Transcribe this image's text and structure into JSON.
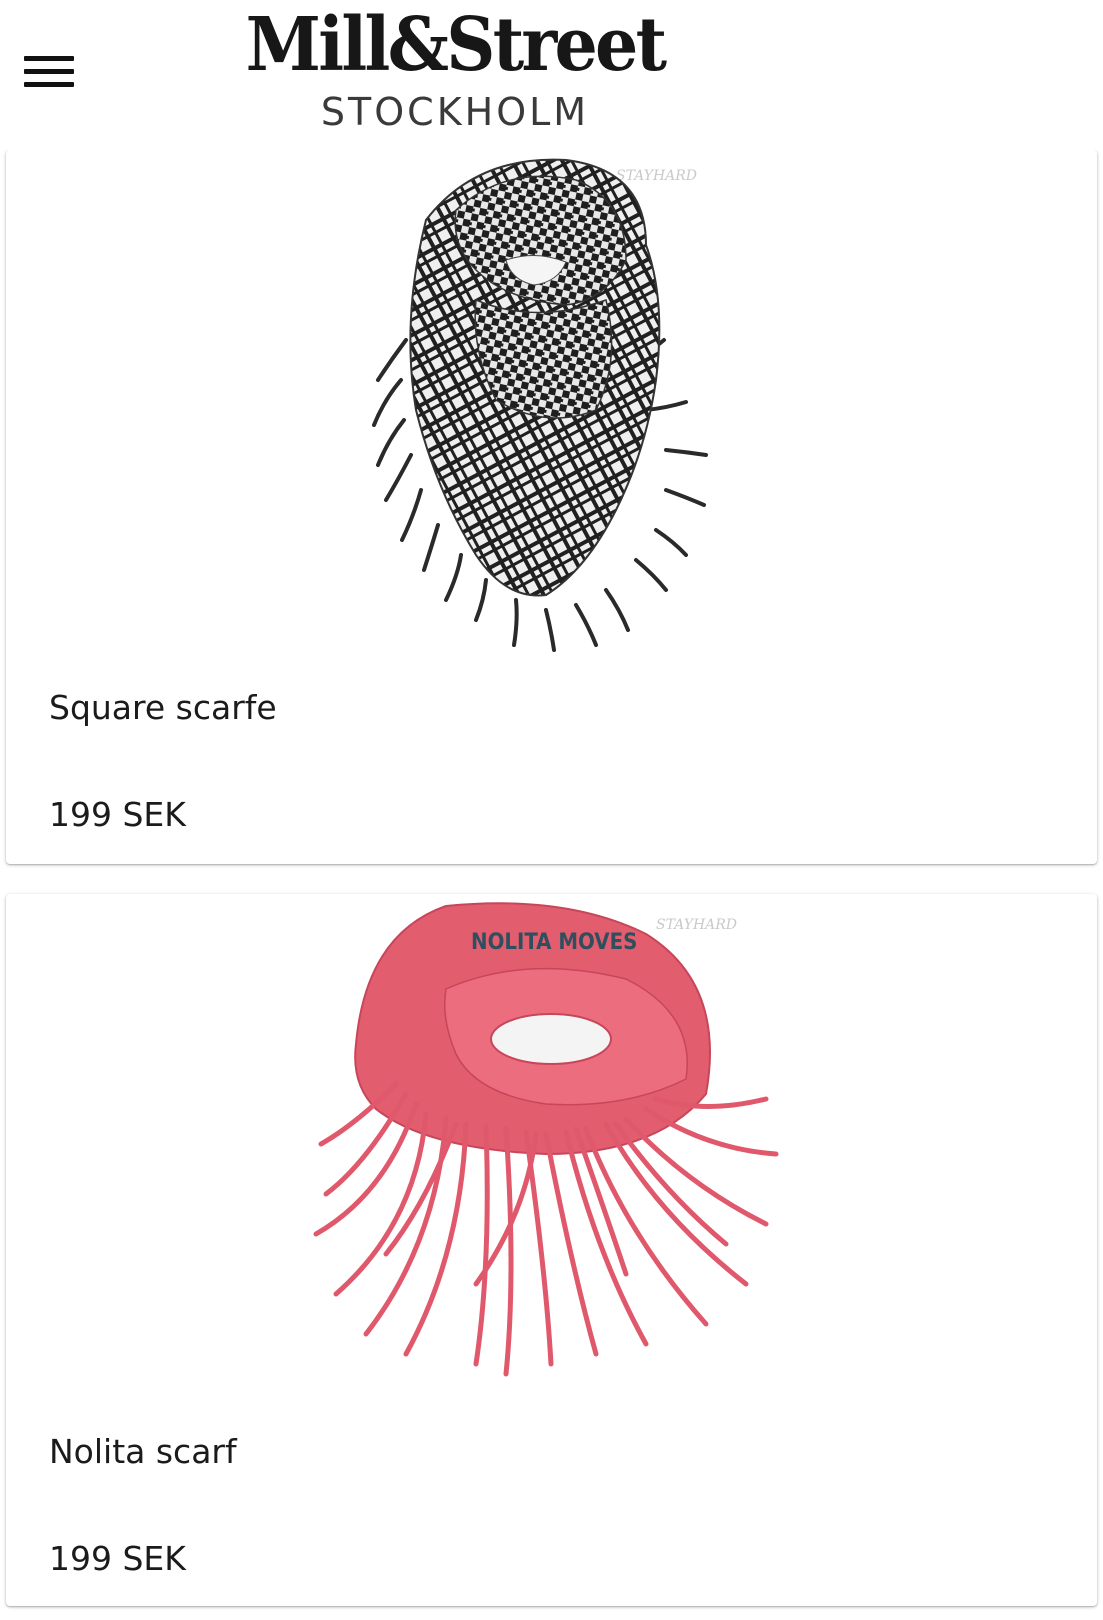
{
  "header": {
    "logo_main": "Mill&Street",
    "logo_sub": "STOCKHOLM",
    "menu_icon": "hamburger-menu-icon"
  },
  "products": [
    {
      "title": "Square scarfe",
      "price": "199 SEK",
      "image_watermark": "STAYHARD",
      "image_color": "#2b2b2b"
    },
    {
      "title": "Nolita scarf",
      "price": "199 SEK",
      "image_watermark": "STAYHARD",
      "image_label": "NOLITA MOVES",
      "image_color": "#e55a6c"
    }
  ]
}
